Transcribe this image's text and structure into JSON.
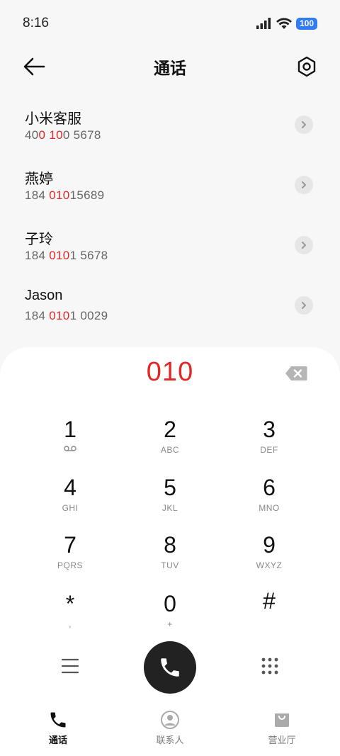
{
  "status_bar": {
    "time": "8:16",
    "battery": "100"
  },
  "header": {
    "title": "通话"
  },
  "results": [
    {
      "name": "小米客服",
      "number_parts": [
        [
          "40",
          false
        ],
        [
          "0",
          true
        ],
        [
          " ",
          false
        ],
        [
          "10",
          true
        ],
        [
          "0 5678",
          false
        ]
      ]
    },
    {
      "name": "燕婷",
      "number_parts": [
        [
          "184 ",
          false
        ],
        [
          "010",
          true
        ],
        [
          "15689",
          false
        ]
      ]
    },
    {
      "name": "子玲",
      "number_parts": [
        [
          "184 ",
          false
        ],
        [
          "010",
          true
        ],
        [
          "1 5678",
          false
        ]
      ]
    },
    {
      "name": "Jason",
      "number_parts": [
        [
          "184 ",
          false
        ],
        [
          "010",
          true
        ],
        [
          "1 0029",
          false
        ]
      ]
    }
  ],
  "dialer": {
    "input": "010",
    "keys": [
      {
        "digit": "1",
        "letters": "",
        "voicemail": true
      },
      {
        "digit": "2",
        "letters": "ABC"
      },
      {
        "digit": "3",
        "letters": "DEF"
      },
      {
        "digit": "4",
        "letters": "GHI"
      },
      {
        "digit": "5",
        "letters": "JKL"
      },
      {
        "digit": "6",
        "letters": "MNO"
      },
      {
        "digit": "7",
        "letters": "PQRS"
      },
      {
        "digit": "8",
        "letters": "TUV"
      },
      {
        "digit": "9",
        "letters": "WXYZ"
      },
      {
        "digit": "*",
        "letters": ","
      },
      {
        "digit": "0",
        "letters": "+"
      },
      {
        "digit": "#",
        "letters": ""
      }
    ]
  },
  "tabs": [
    {
      "label": "通话",
      "icon": "phone-icon",
      "active": true
    },
    {
      "label": "联系人",
      "icon": "contact-icon",
      "active": false
    },
    {
      "label": "营业厅",
      "icon": "shopping-bag-icon",
      "active": false
    }
  ],
  "colors": {
    "highlight": "#e32626",
    "accent": "#2f7cf6",
    "call_button": "#222222"
  }
}
